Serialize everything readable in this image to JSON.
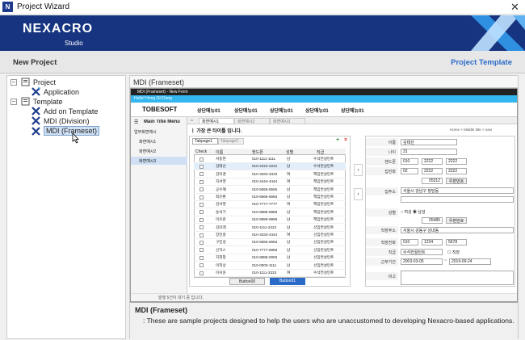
{
  "window": {
    "title": "Project Wizard",
    "close": "✕"
  },
  "banner": {
    "logo": "NEXACRO",
    "subtitle": "Studio"
  },
  "header": {
    "left": "New Project",
    "right": "Project Template"
  },
  "tree": {
    "items": [
      "Project",
      "Application",
      "Template",
      "Add on Template",
      "MDI (Division)",
      "MDI (Frameset)"
    ]
  },
  "preview_title": "MDI (Frameset)",
  "inner": {
    "titlebar": "MDI (Frameset) - New Form",
    "greeting": "Hello! Hong Gil Dong",
    "brand": "TOBESOFT",
    "menus": [
      "상단메뉴01",
      "상단메뉴01",
      "상단메뉴01",
      "상단메뉴01",
      "상단메뉴01"
    ],
    "left_title": "Main Title Menu",
    "left_items": [
      "업무화면예시",
      "화면예시1",
      "화면예시2",
      "화면예시3"
    ],
    "tabs": [
      "화면예시1",
      "화면예시2",
      "화면예시3"
    ],
    "page_heading": "ㅣ 가장 큰 타이틀 입니다.",
    "breadcrumb": "Home > Middle title > navi",
    "subtabs": [
      "Tabpage1",
      "Tabpage2"
    ],
    "grid_headers": [
      "Check",
      "이름",
      "핸드폰",
      "성별",
      "직급"
    ],
    "grid_rows": [
      [
        "서동현",
        "010-1111-1111",
        "남",
        "수석컨설턴트"
      ],
      [
        "김태산",
        "010-2222-2222",
        "남",
        "수석컨설턴트"
      ],
      [
        "김미경",
        "010-3333-3333",
        "여",
        "책임컨설턴트"
      ],
      [
        "지서영",
        "010-4444-4444",
        "여",
        "책임컨설턴트"
      ],
      [
        "공수혜",
        "010-5555-5555",
        "남",
        "책임컨설턴트"
      ],
      [
        "최유환",
        "010-6666-6666",
        "남",
        "책임컨설턴트"
      ],
      [
        "김서영",
        "010-7777-7777",
        "여",
        "책임컨설턴트"
      ],
      [
        "송석기",
        "010-8888-8888",
        "남",
        "책임컨설턴트"
      ],
      [
        "이유준",
        "010-9999-9999",
        "남",
        "책임컨설턴트"
      ],
      [
        "김미래",
        "010-1111-2222",
        "남",
        "선임컨설턴트"
      ],
      [
        "장민홍",
        "010-3333-4444",
        "여",
        "선임컨설턴트"
      ],
      [
        "구민성",
        "010-5555-6666",
        "남",
        "선임컨설턴트"
      ],
      [
        "신하스",
        "010-7777-8888",
        "남",
        "선임컨설턴트"
      ],
      [
        "지현창",
        "010-8888-0000",
        "남",
        "선임컨설턴트"
      ],
      [
        "이혁상",
        "010-0000-1111",
        "남",
        "선임컨설턴트"
      ],
      [
        "이서윤",
        "010-1111-3333",
        "여",
        "수석컨설턴트"
      ]
    ],
    "buttons": [
      "Button00",
      "Button01"
    ],
    "form_labels": [
      "이름",
      "나이",
      "핸드폰",
      "집전화",
      "집주소",
      "성별",
      "직장주소",
      "직장전화",
      "직급",
      "근무기간",
      "비고"
    ],
    "form_values": {
      "name": "김태산",
      "age": "31",
      "phone": [
        "010",
        "2222",
        "2222"
      ],
      "home": [
        "02",
        "2222",
        "2222"
      ],
      "zip1": "05312",
      "zip_btn": "우편번호",
      "addr1": "서울시 강남구 청담동",
      "gender": [
        "여성",
        "남성"
      ],
      "zip2": "05485",
      "addr2": "서울시 강동구 성내동",
      "work": [
        "010",
        "1234",
        "5678"
      ],
      "rank": "수석컨설턴트",
      "rank_chk": "직장",
      "from": "2003-03-05",
      "to": "2019-09-24"
    },
    "status": "발행 5건이 대기 중 입니다."
  },
  "description": {
    "title": "MDI (Frameset)",
    "text": "These are sample projects designed to help the users who are unaccustomed to developing Nexacro-based applications."
  },
  "colors": {
    "brand": "#16347f",
    "accent": "#2a6bc8",
    "selection": "#cfe0f5"
  }
}
